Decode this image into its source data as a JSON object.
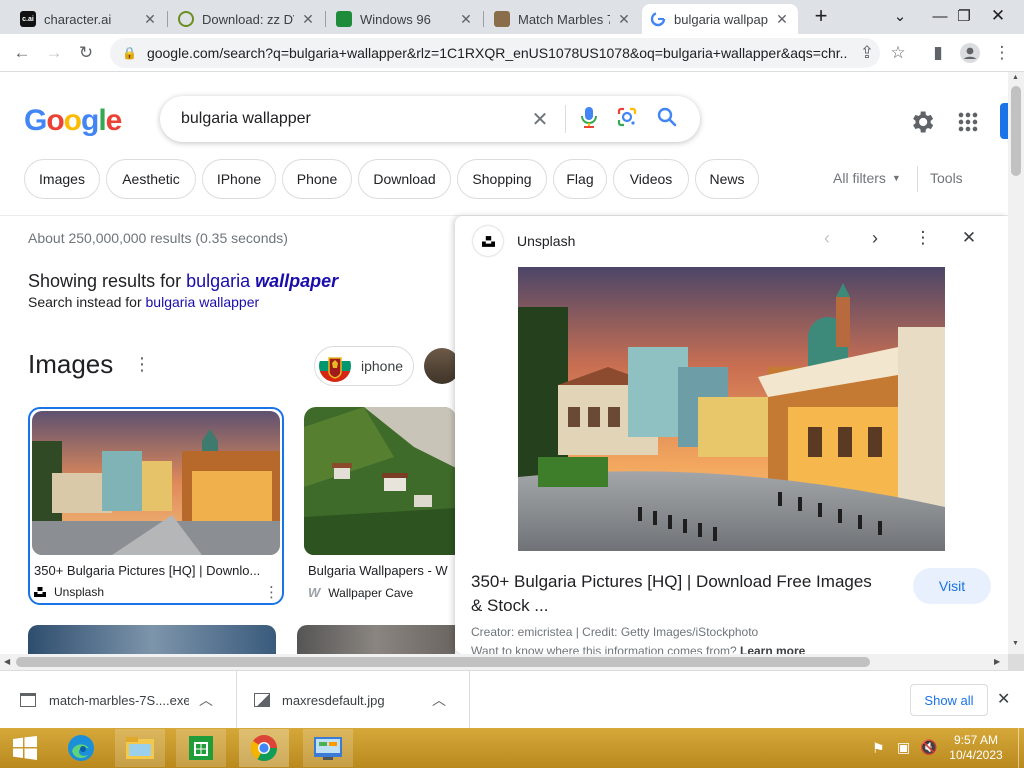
{
  "tabs": [
    {
      "label": "character.ai",
      "favicon": "c.ai"
    },
    {
      "label": "Download: zz DVD",
      "favicon": "dl"
    },
    {
      "label": "Windows 96",
      "favicon": "w96"
    },
    {
      "label": "Match Marbles 7",
      "favicon": "mm"
    },
    {
      "label": "bulgaria wallpape",
      "favicon": "G"
    }
  ],
  "address": {
    "url": "google.com/search?q=bulgaria+wallapper&rlz=1C1RXQR_enUS1078US1078&oq=bulgaria+wallapper&aqs=chr..."
  },
  "search": {
    "logo": [
      "G",
      "o",
      "o",
      "g",
      "l",
      "e"
    ],
    "query": "bulgaria wallapper",
    "chips": [
      "Images",
      "Aesthetic",
      "IPhone",
      "Phone",
      "Download",
      "Shopping",
      "Flag",
      "Videos",
      "News"
    ],
    "all_filters": "All filters",
    "tools": "Tools"
  },
  "results": {
    "stats": "About 250,000,000 results (0.35 seconds)",
    "showing_prefix": "Showing results for ",
    "showing_link": "bulgaria ",
    "showing_bold": "wallpaper",
    "instead_prefix": "Search instead for ",
    "instead_link": "bulgaria wallapper",
    "images_heading": "Images",
    "refine_chip": "iphone",
    "cards": [
      {
        "title": "350+ Bulgaria Pictures [HQ] | Downlo...",
        "source": "Unsplash"
      },
      {
        "title": "Bulgaria Wallpapers - W",
        "source": "Wallpaper Cave"
      }
    ]
  },
  "panel": {
    "source": "Unsplash",
    "title_line1": "350+ Bulgaria Pictures [HQ] | Download Free Images",
    "title_line2": "& Stock ...",
    "visit": "Visit",
    "credit": "Creator: emicristea | Credit: Getty Images/iStockphoto",
    "info_prefix": "Want to know where this information comes from? ",
    "info_link": "Learn more"
  },
  "downloads": {
    "items": [
      {
        "name": "match-marbles-7S....exe"
      },
      {
        "name": "maxresdefault.jpg"
      }
    ],
    "show_all": "Show all"
  },
  "taskbar": {
    "time": "9:57 AM",
    "date": "10/4/2023"
  },
  "colors": {
    "google_blue": "#4285f4",
    "google_red": "#ea4335",
    "google_yellow": "#fbbc05",
    "google_green": "#34a853",
    "link": "#1a0dab",
    "selected_card": "#1a73e8",
    "taskbar": "#c89b2a"
  }
}
